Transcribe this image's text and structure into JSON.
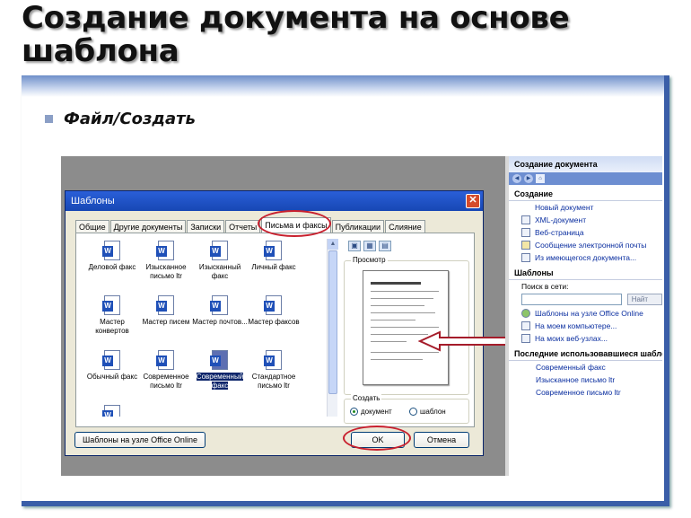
{
  "slide": {
    "title": "Создание документа на основе шаблона",
    "bullet": "Файл/Создать"
  },
  "dialog": {
    "title": "Шаблоны",
    "tabs": [
      {
        "label": "Общие",
        "active": false
      },
      {
        "label": "Другие документы",
        "active": false
      },
      {
        "label": "Записки",
        "active": false
      },
      {
        "label": "Отчеты",
        "active": false
      },
      {
        "label": "Письма и факсы",
        "active": true
      },
      {
        "label": "Публикации",
        "active": false
      },
      {
        "label": "Слияние",
        "active": false
      }
    ],
    "templates": [
      {
        "label": "Деловой факс",
        "selected": false
      },
      {
        "label": "Изысканное письмо ltr",
        "selected": false
      },
      {
        "label": "Изысканный факс",
        "selected": false
      },
      {
        "label": "Личный факс",
        "selected": false
      },
      {
        "label": "Мастер конвертов",
        "selected": false
      },
      {
        "label": "Мастер писем",
        "selected": false
      },
      {
        "label": "Мастер почтов...",
        "selected": false
      },
      {
        "label": "Мастер факсов",
        "selected": false
      },
      {
        "label": "Обычный факс",
        "selected": false
      },
      {
        "label": "Современное письмо ltr",
        "selected": false
      },
      {
        "label": "Современный факс",
        "selected": true
      },
      {
        "label": "Стандартное письмо ltr",
        "selected": false
      },
      {
        "label": "",
        "selected": false
      }
    ],
    "preview_label": "Просмотр",
    "create_label": "Создать",
    "radio_document": "документ",
    "radio_template": "шаблон",
    "office_online_button": "Шаблоны на узле Office Online",
    "ok_button": "OK",
    "cancel_button": "Отмена"
  },
  "taskpane": {
    "header": "Создание документа",
    "create_section": "Создание",
    "create_links": [
      "Новый документ",
      "XML-документ",
      "Веб-страница",
      "Сообщение электронной почты",
      "Из имеющегося документа..."
    ],
    "templates_section": "Шаблоны",
    "search_label": "Поиск в сети:",
    "search_go": "Найт",
    "template_links": [
      "Шаблоны на узле Office Online",
      "На моем компьютере...",
      "На моих веб-узлах..."
    ],
    "recent_section": "Последние использовавшиеся шабло",
    "recent_links": [
      "Современный факс",
      "Изысканное письмо ltr",
      "Современное письмо ltr"
    ]
  },
  "colors": {
    "highlight_oval": "#c8202e",
    "titlebar": "#1747b4",
    "frame_border": "#3a5ea8"
  }
}
